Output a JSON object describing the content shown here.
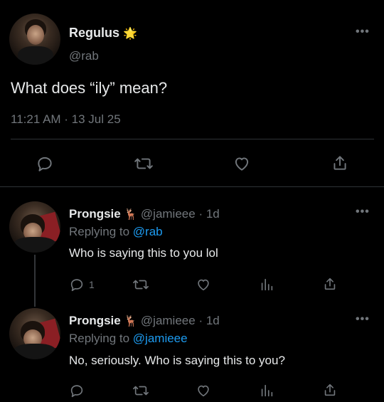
{
  "main_tweet": {
    "author_name": "Regulus",
    "verified_emoji": "🌟",
    "handle": "@rab",
    "text": "What does “ily” mean?",
    "timestamp": "11:21 AM · 13 Jul 25",
    "actions": [
      "reply-icon",
      "retweet-icon",
      "like-icon",
      "share-icon"
    ]
  },
  "replies": [
    {
      "author_name": "Prongsie",
      "name_emoji": "🦌",
      "handle": "@jamieee",
      "age": "· 1d",
      "replying_prefix": "Replying to",
      "replying_to": "@rab",
      "text": "Who is saying this to you lol",
      "reply_count": "1"
    },
    {
      "author_name": "Prongsie",
      "name_emoji": "🦌",
      "handle": "@jamieee",
      "age": "· 1d",
      "replying_prefix": "Replying to",
      "replying_to": "@jamieee",
      "text": "No, seriously. Who is saying this to you?",
      "reply_count": ""
    }
  ],
  "more_label": "•••",
  "colors": {
    "accent": "#1d9bf0",
    "muted": "#71767b",
    "text": "#e7e9ea",
    "divider": "#2f3336"
  }
}
